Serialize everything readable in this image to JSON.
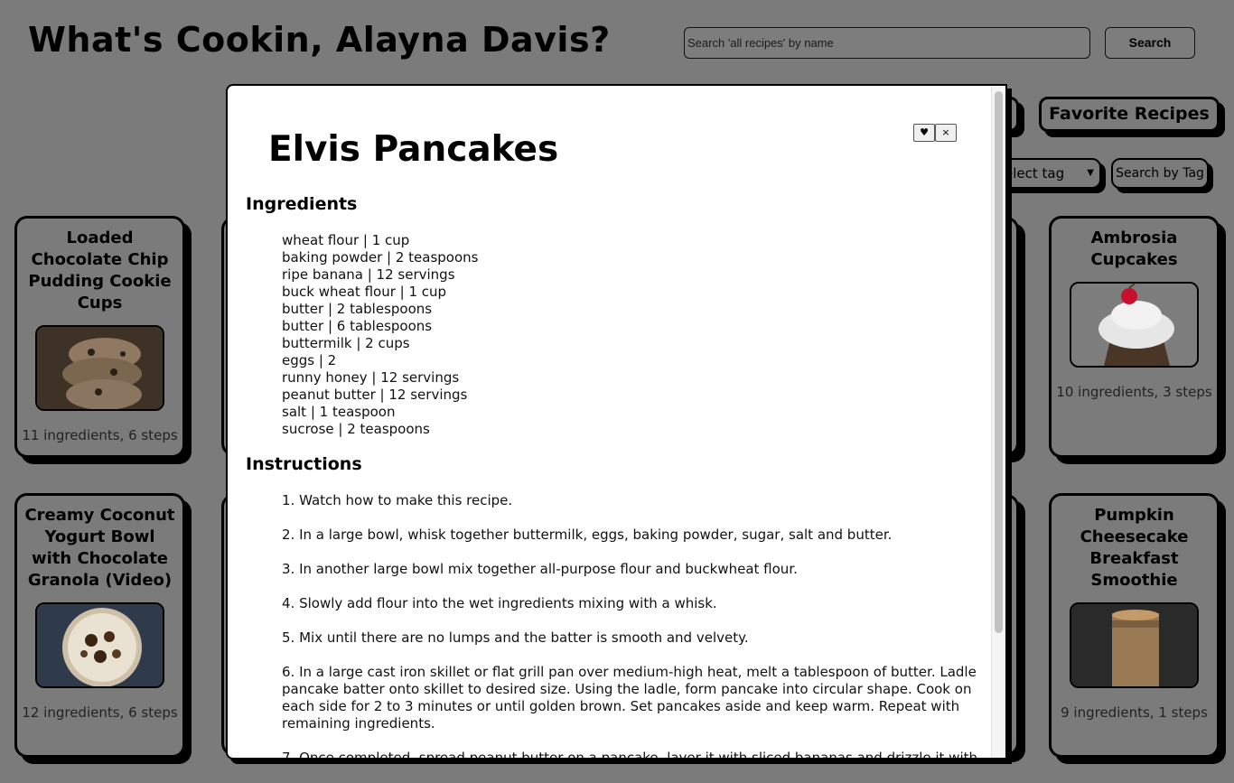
{
  "header": {
    "title": "What's Cookin, Alayna Davis?",
    "search_placeholder": "Search 'all recipes' by name",
    "search_label": "Search"
  },
  "nav": {
    "favorite_label": "Favorite Recipes",
    "tag_select_value": "elect tag",
    "tag_search_label": "Search by Tag"
  },
  "cards": [
    {
      "title": "Loaded Chocolate Chip Pudding Cookie Cups",
      "meta": "11 ingredients, 6 steps",
      "image": "cookie-cups-photo"
    },
    {
      "title": "Ambrosia Cupcakes",
      "meta": "10 ingredients, 3 steps",
      "image": "cupcake-photo"
    },
    {
      "title": "Creamy Coconut Yogurt Bowl with Chocolate Granola (Video)",
      "meta": "12 ingredients, 6 steps",
      "image": "yogurt-bowl-photo"
    },
    {
      "title": "Pumpkin Cheesecake Breakfast Smoothie",
      "meta": "9 ingredients, 1 steps",
      "image": "smoothie-photo"
    }
  ],
  "modal": {
    "title": "Elvis Pancakes",
    "favorite_icon": "♥",
    "close_icon": "×",
    "ingredients_heading": "Ingredients",
    "ingredients": [
      "wheat flour | 1 cup",
      "baking powder | 2 teaspoons",
      "ripe banana | 12 servings",
      "buck wheat flour | 1 cup",
      "butter | 2 tablespoons",
      "butter | 6 tablespoons",
      "buttermilk | 2 cups",
      "eggs | 2",
      "runny honey | 12 servings",
      "peanut butter | 12 servings",
      "salt | 1 teaspoon",
      "sucrose | 2 teaspoons"
    ],
    "instructions_heading": "Instructions",
    "instructions": [
      "1. Watch how to make this recipe.",
      "2. In a large bowl, whisk together buttermilk, eggs, baking powder, sugar, salt and butter.",
      "3. In another large bowl mix together all-purpose flour and buckwheat flour.",
      "4. Slowly add flour into the wet ingredients mixing with a whisk.",
      "5. Mix until there are no lumps and the batter is smooth and velvety.",
      "6. In a large cast iron skillet or flat grill pan over medium-high heat, melt a tablespoon of butter. Ladle pancake batter onto skillet to desired size. Using the ladle, form pancake into circular shape. Cook on each side for 2 to 3 minutes or until golden brown. Set pancakes aside and keep warm. Repeat with remaining ingredients.",
      "7. Once completed, spread peanut butter on a pancake, layer it with sliced bananas and drizzle it with"
    ]
  }
}
